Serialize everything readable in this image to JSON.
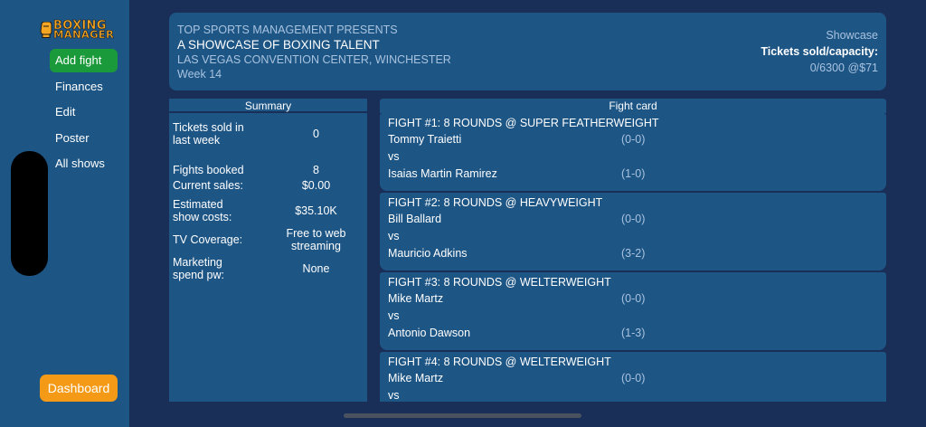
{
  "app": {
    "logo_line1": "BOXING",
    "logo_line2": "MANAGER"
  },
  "sidebar": {
    "items": [
      {
        "label": "Add fight",
        "active": true
      },
      {
        "label": "Finances"
      },
      {
        "label": "Edit"
      },
      {
        "label": "Poster"
      },
      {
        "label": "All shows"
      }
    ],
    "dashboard_label": "Dashboard"
  },
  "header": {
    "presenter": "TOP SPORTS MANAGEMENT PRESENTS",
    "title": "A SHOWCASE OF BOXING TALENT",
    "venue": "LAS VEGAS CONVENTION CENTER, WINCHESTER",
    "week": "Week 14",
    "show_type": "Showcase",
    "tickets_label": "Tickets sold/capacity:",
    "tickets_value": "0/6300 @$71"
  },
  "summary": {
    "title": "Summary",
    "rows": [
      {
        "label": "Tickets sold in\nlast week",
        "value": "0"
      },
      {
        "label": "Fights booked",
        "value": "8"
      },
      {
        "label": "Current sales:",
        "value": "$0.00"
      },
      {
        "label": "Estimated\nshow costs:",
        "value": "$35.10K"
      },
      {
        "label": "TV Coverage:",
        "value": "Free to web\nstreaming"
      },
      {
        "label": "Marketing\nspend pw:",
        "value": "None"
      }
    ]
  },
  "fightcard": {
    "title": "Fight card",
    "vs_label": "vs",
    "fights": [
      {
        "title": "FIGHT #1: 8 ROUNDS @ SUPER FEATHERWEIGHT",
        "boxer_a": "Tommy Traietti",
        "record_a": "(0-0)",
        "boxer_b": "Isaias Martin Ramirez",
        "record_b": "(1-0)"
      },
      {
        "title": "FIGHT #2: 8 ROUNDS @ HEAVYWEIGHT",
        "boxer_a": "Bill Ballard",
        "record_a": "(0-0)",
        "boxer_b": "Mauricio Adkins",
        "record_b": "(3-2)"
      },
      {
        "title": "FIGHT #3: 8 ROUNDS @ WELTERWEIGHT",
        "boxer_a": "Mike Martz",
        "record_a": "(0-0)",
        "boxer_b": "Antonio Dawson",
        "record_b": "(1-3)"
      },
      {
        "title": "FIGHT #4: 8 ROUNDS @ WELTERWEIGHT",
        "boxer_a": "Mike Martz",
        "record_a": "(0-0)",
        "boxer_b": "",
        "record_b": ""
      }
    ]
  }
}
